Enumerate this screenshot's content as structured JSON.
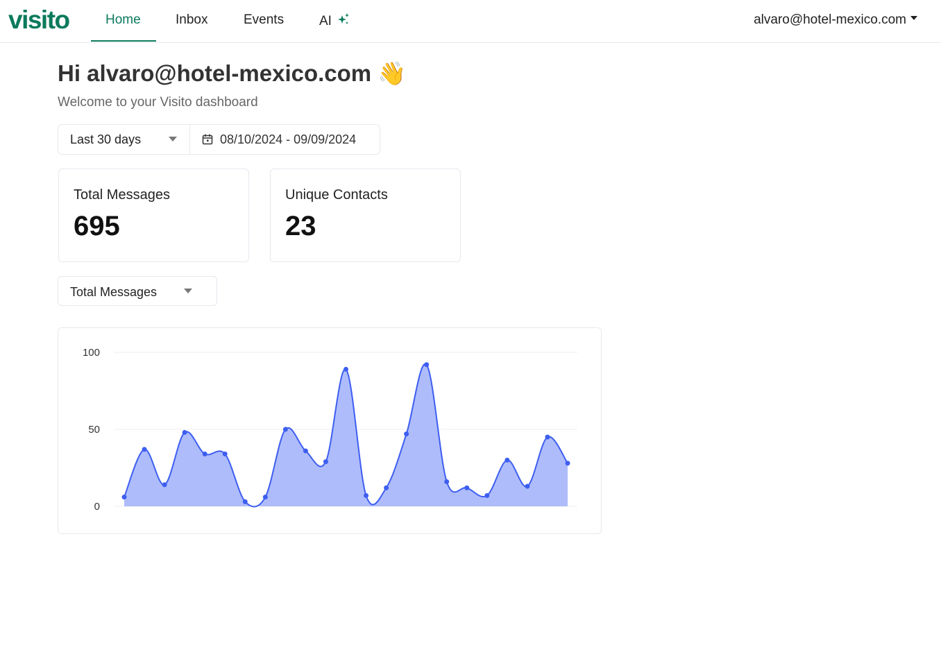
{
  "nav": {
    "logo": "visito",
    "tabs": [
      {
        "label": "Home"
      },
      {
        "label": "Inbox"
      },
      {
        "label": "Events"
      },
      {
        "label": "AI"
      }
    ],
    "user": "alvaro@hotel-mexico.com"
  },
  "greeting": {
    "title": "Hi alvaro@hotel-mexico.com 👋",
    "subtitle": "Welcome to your Visito dashboard"
  },
  "filters": {
    "range": "Last 30 days",
    "dates": "08/10/2024 - 09/09/2024",
    "metric": "Total Messages"
  },
  "stats": [
    {
      "label": "Total Messages",
      "value": "695"
    },
    {
      "label": "Unique Contacts",
      "value": "23"
    }
  ],
  "colors": {
    "brand": "#0b7a5c",
    "line": "#3d5ef0",
    "fill": "#aab8fb"
  },
  "chart_data": {
    "type": "area",
    "title": "",
    "xlabel": "",
    "ylabel": "",
    "ylim": [
      0,
      100
    ],
    "yticks": [
      "0",
      "50",
      "100"
    ],
    "grid": true,
    "values": [
      6,
      37,
      14,
      48,
      34,
      34,
      3,
      6,
      50,
      36,
      29,
      89,
      7,
      12,
      47,
      92,
      16,
      12,
      7,
      30,
      13,
      45,
      28
    ]
  }
}
